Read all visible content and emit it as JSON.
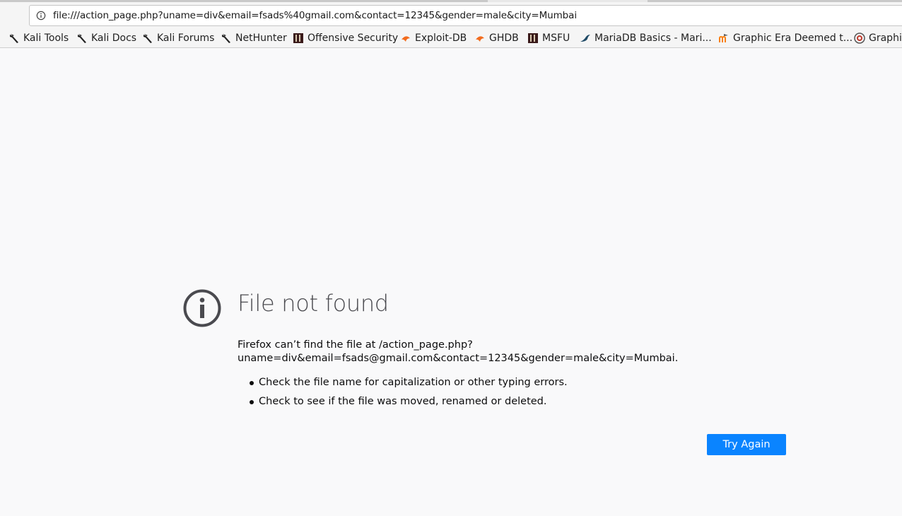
{
  "browser": {
    "url": "file:///action_page.php?uname=div&email=fsads%40gmail.com&contact=12345&gender=male&city=Mumbai",
    "bookmarks": [
      {
        "label": "Kali Tools",
        "icon": "kali-dragon-icon"
      },
      {
        "label": "Kali Docs",
        "icon": "kali-dragon-icon"
      },
      {
        "label": "Kali Forums",
        "icon": "kali-dragon-icon"
      },
      {
        "label": "NetHunter",
        "icon": "kali-dragon-icon"
      },
      {
        "label": "Offensive Security",
        "icon": "offsec-icon"
      },
      {
        "label": "Exploit-DB",
        "icon": "exploitdb-bug-icon"
      },
      {
        "label": "GHDB",
        "icon": "exploitdb-bug-icon"
      },
      {
        "label": "MSFU",
        "icon": "offsec-icon"
      },
      {
        "label": "MariaDB Basics - Mari...",
        "icon": "mariadb-seal-icon"
      },
      {
        "label": "Graphic Era Deemed t...",
        "icon": "moodle-icon"
      },
      {
        "label": "Graphi",
        "icon": "graphic-era-logo-icon"
      }
    ]
  },
  "error_page": {
    "title": "File not found",
    "description": "Firefox can’t find the file at /action_page.php?uname=div&email=fsads@gmail.com&contact=12345&gender=male&city=Mumbai.",
    "suggestions": [
      "Check the file name for capitalization or other typing errors.",
      "Check to see if the file was moved, renamed or deleted."
    ],
    "try_again_label": "Try Again",
    "colors": {
      "button": "#0a84ff",
      "icon": "#4a4a4f",
      "background": "#f9f9fa"
    }
  }
}
